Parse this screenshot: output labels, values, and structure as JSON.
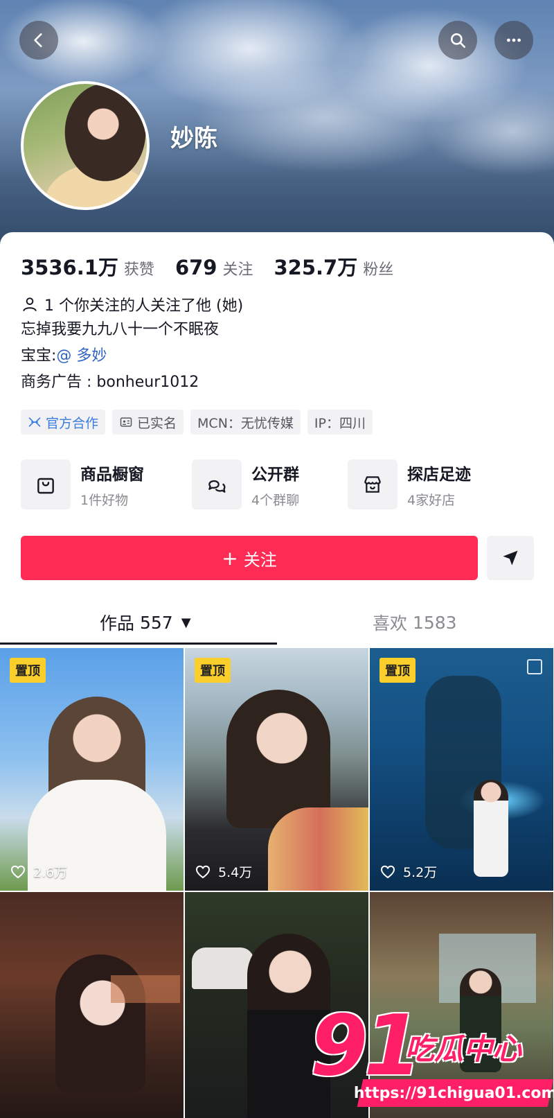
{
  "header": {
    "nickname": "妙陈",
    "back_icon": "back-arrow-icon",
    "search_icon": "search-icon",
    "more_icon": "more-dots-icon"
  },
  "stats": [
    {
      "value": "3536.1万",
      "label": "获赞"
    },
    {
      "value": "679",
      "label": "关注"
    },
    {
      "value": "325.7万",
      "label": "粉丝"
    }
  ],
  "mutual": {
    "text": "1 个你关注的人关注了他 (她)"
  },
  "bio": {
    "line1": "忘掉我要九九八十一个不眠夜",
    "line2_prefix": "宝宝:",
    "line2_mention": "@ 多妙",
    "line3": "商务广告 : bonheur1012"
  },
  "tags": {
    "official": "官方合作",
    "verified": "已实名",
    "mcn": "MCN：无忧传媒",
    "ip": "IP：四川"
  },
  "shortcuts": [
    {
      "title": "商品橱窗",
      "sub": "1件好物",
      "icon": "shopping-bag-icon"
    },
    {
      "title": "公开群",
      "sub": "4个群聊",
      "icon": "chat-bubbles-icon"
    },
    {
      "title": "探店足迹",
      "sub": "4家好店",
      "icon": "store-icon"
    }
  ],
  "actions": {
    "follow_plus": "+",
    "follow_label": "关注",
    "share_icon": "send-icon"
  },
  "tabs": {
    "works_label": "作品",
    "works_count": "557",
    "caret": "▼",
    "likes_label": "喜欢",
    "likes_count": "1583"
  },
  "videos": [
    {
      "pinned": "置顶",
      "likes": "2.6万"
    },
    {
      "pinned": "置顶",
      "likes": "5.4万"
    },
    {
      "pinned": "置顶",
      "likes": "5.2万"
    },
    {
      "pinned": "",
      "likes": ""
    },
    {
      "pinned": "",
      "likes": ""
    },
    {
      "pinned": "",
      "likes": ""
    }
  ],
  "watermark": {
    "number": "91",
    "text": "吃瓜中心",
    "url": "https://91chigua01.com"
  },
  "colors": {
    "follow_button": "#fe2c55",
    "pin_badge": "#fbcf2b",
    "mention": "#2e63c5",
    "watermark": "#ff1f67"
  }
}
